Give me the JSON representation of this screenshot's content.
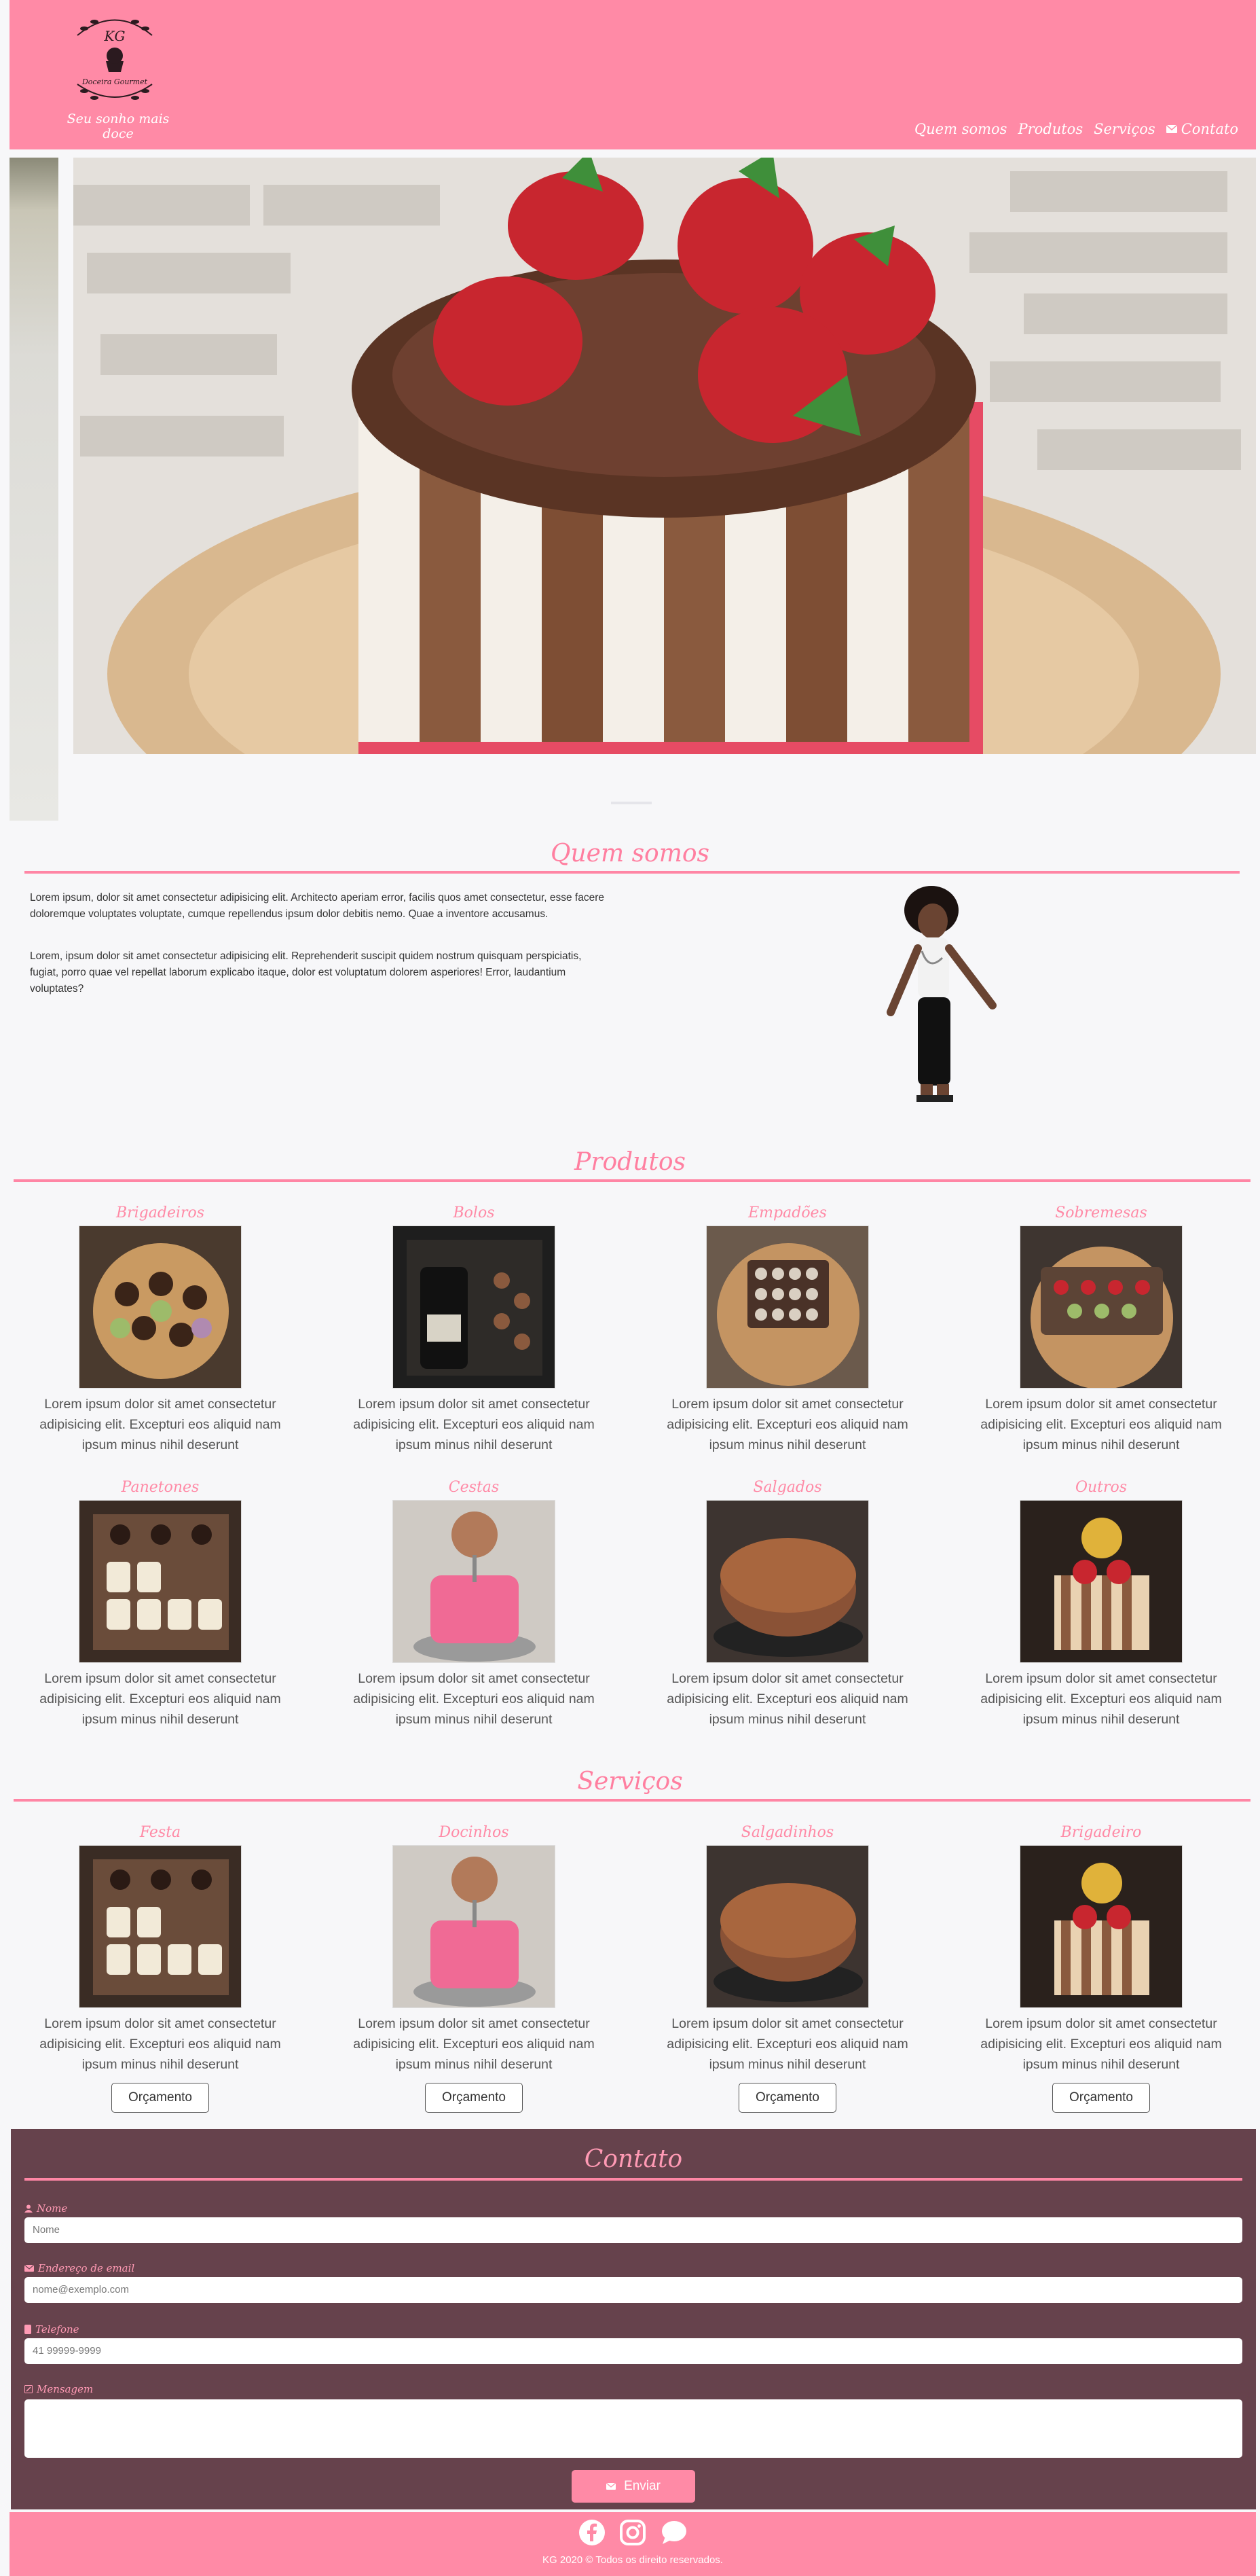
{
  "header": {
    "logo_initials": "KG",
    "logo_brand": "Doceira Gourmet",
    "tagline": "Seu sonho mais doce",
    "nav": [
      "Quem somos",
      "Produtos",
      "Serviços",
      "Contato"
    ]
  },
  "about": {
    "title": "Quem somos",
    "p1": "Lorem ipsum, dolor sit amet consectetur adipisicing elit. Architecto aperiam error, facilis quos amet consectetur, esse facere doloremque voluptates voluptate, cumque repellendus ipsum dolor debitis nemo. Quae a inventore accusamus.",
    "p2": "Lorem, ipsum dolor sit amet consectetur adipisicing elit. Reprehenderit suscipit quidem nostrum quisquam perspiciatis, fugiat, porro quae vel repellat laborum explicabo itaque, dolor est voluptatum dolorem asperiores! Error, laudantium voluptates?"
  },
  "produtos": {
    "title": "Produtos",
    "desc": "Lorem ipsum dolor sit amet consectetur adipisicing elit. Excepturi eos aliquid nam ipsum minus nihil deserunt",
    "items": [
      "Brigadeiros",
      "Bolos",
      "Empadões",
      "Sobremesas",
      "Panetones",
      "Cestas",
      "Salgados",
      "Outros"
    ]
  },
  "servicos": {
    "title": "Serviços",
    "desc": "Lorem ipsum dolor sit amet consectetur adipisicing elit. Excepturi eos aliquid nam ipsum minus nihil deserunt",
    "button": "Orçamento",
    "items": [
      "Festa",
      "Docinhos",
      "Salgadinhos",
      "Brigadeiro"
    ]
  },
  "contato": {
    "title": "Contato",
    "name_label": "Nome",
    "name_placeholder": "Nome",
    "email_label": "Endereço de email",
    "email_placeholder": "nome@exemplo.com",
    "phone_label": "Telefone",
    "phone_placeholder": "41 99999-9999",
    "message_label": "Mensagem",
    "send": "Enviar"
  },
  "footer": {
    "copyright": "KG 2020 © Todos os direito reservados."
  },
  "colors": {
    "brand_pink": "#ff8aa6",
    "contact_bg": "#66424c"
  }
}
